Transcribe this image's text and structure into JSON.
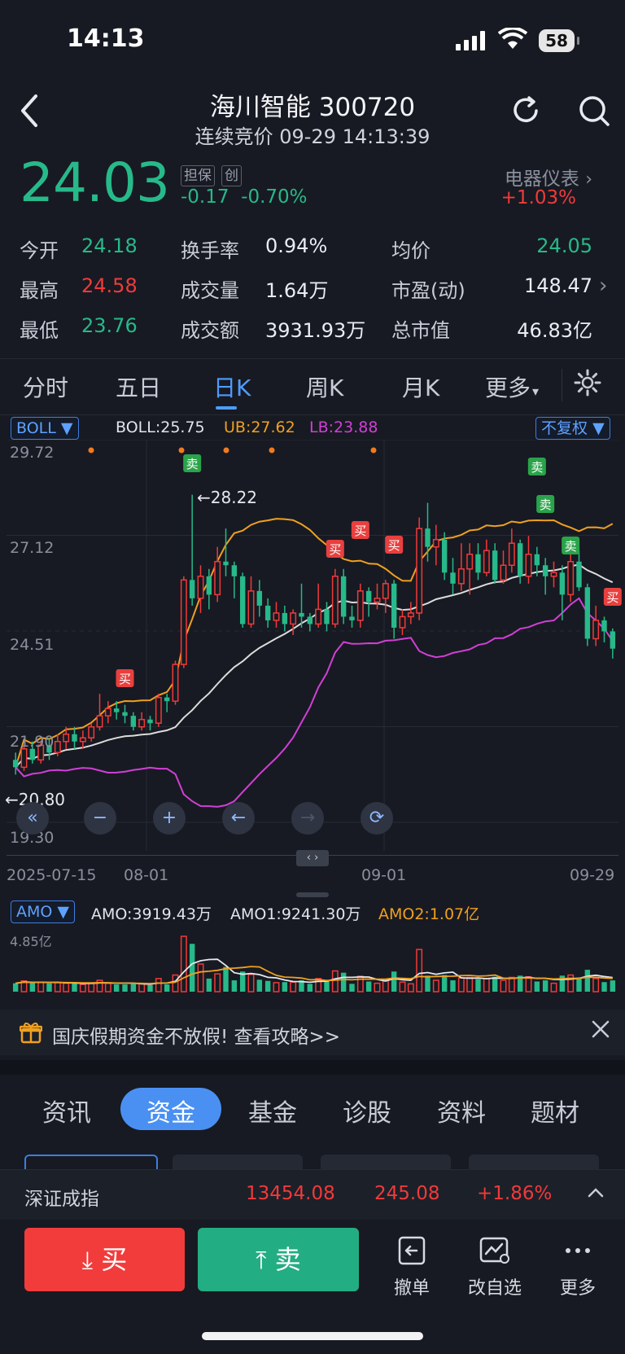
{
  "status_bar": {
    "time": "14:13",
    "battery": "58"
  },
  "header": {
    "title": "海川智能 300720",
    "subtitle": "连续竞价 09-29 14:13:39"
  },
  "quote": {
    "price": "24.03",
    "tag_1": "担保",
    "tag_2": "创",
    "change": "-0.17",
    "change_pct": "-0.70%",
    "sector_name": "电器仪表",
    "sector_pct": "+1.03%"
  },
  "stats": {
    "open_label": "今开",
    "open": "24.18",
    "high_label": "最高",
    "high": "24.58",
    "low_label": "最低",
    "low": "23.76",
    "turnover_label": "换手率",
    "turnover": "0.94%",
    "volume_label": "成交量",
    "volume": "1.64万",
    "amount_label": "成交额",
    "amount": "3931.93万",
    "avg_label": "均价",
    "avg": "24.05",
    "pe_label": "市盈(动)",
    "pe": "148.47",
    "mktcap_label": "总市值",
    "mktcap": "46.83亿"
  },
  "period_tabs": [
    "分时",
    "五日",
    "日K",
    "周K",
    "月K",
    "更多"
  ],
  "indicator": {
    "selector": "BOLL",
    "boll": "BOLL:25.75",
    "ub": "UB:27.62",
    "lb": "LB:23.88",
    "adjust": "不复权"
  },
  "chart_axis": {
    "y_ticks": [
      "29.72",
      "27.12",
      "24.51",
      "21.90",
      "19.30"
    ],
    "x_ticks": [
      "2025-07-15",
      "08-01",
      "09-01",
      "09-29"
    ],
    "max_label": "28.22",
    "min_label": "20.80"
  },
  "signals": {
    "buy": "买",
    "sell": "卖"
  },
  "amo": {
    "selector": "AMO",
    "amo": "AMO:3919.43万",
    "amo1": "AMO1:9241.30万",
    "amo2": "AMO2:1.07亿",
    "max": "4.85亿"
  },
  "banner": {
    "text": "国庆假期资金不放假! 查看攻略>>"
  },
  "news_tabs": [
    "资讯",
    "资金",
    "基金",
    "诊股",
    "资料",
    "题材"
  ],
  "index_bar": {
    "name": "深证成指",
    "value": "13454.08",
    "change": "245.08",
    "pct": "+1.86%"
  },
  "bottom": {
    "buy": "买",
    "sell": "卖",
    "cancel": "撤单",
    "edit_watch": "改自选",
    "more": "更多"
  },
  "colors": {
    "up": "#f03a3a",
    "down": "#27b98a",
    "accent": "#4f9bff",
    "ub_line": "#f0a020",
    "lb_line": "#d23fd6",
    "mid_line": "#dcdcdc"
  },
  "chart_data": {
    "type": "candlestick",
    "x_range": [
      "2025-07-15",
      "09-29"
    ],
    "ylim": [
      19.3,
      29.72
    ],
    "candles": [
      [
        21.0,
        20.8,
        21.2,
        20.6
      ],
      [
        20.8,
        21.3,
        21.4,
        20.7
      ],
      [
        21.3,
        21.0,
        21.5,
        20.9
      ],
      [
        21.0,
        21.4,
        21.5,
        20.9
      ],
      [
        21.4,
        21.2,
        21.6,
        21.0
      ],
      [
        21.2,
        21.5,
        21.7,
        21.1
      ],
      [
        21.5,
        21.7,
        21.9,
        21.3
      ],
      [
        21.7,
        21.5,
        21.9,
        21.3
      ],
      [
        21.5,
        21.6,
        21.8,
        21.3
      ],
      [
        21.6,
        21.9,
        22.0,
        21.5
      ],
      [
        21.9,
        22.2,
        22.8,
        21.8
      ],
      [
        22.2,
        22.4,
        22.6,
        22.0
      ],
      [
        22.4,
        22.3,
        22.6,
        22.1
      ],
      [
        22.3,
        22.2,
        22.5,
        22.0
      ],
      [
        22.2,
        21.9,
        22.3,
        21.8
      ],
      [
        21.9,
        22.1,
        22.3,
        21.8
      ],
      [
        22.1,
        22.0,
        22.2,
        21.8
      ],
      [
        22.0,
        22.7,
        22.8,
        21.9
      ],
      [
        22.7,
        22.6,
        22.8,
        22.3
      ],
      [
        22.6,
        23.6,
        23.7,
        22.5
      ],
      [
        23.6,
        25.9,
        26.0,
        23.5
      ],
      [
        25.9,
        25.4,
        28.22,
        25.2
      ],
      [
        25.4,
        26.0,
        26.3,
        25.0
      ],
      [
        26.0,
        25.5,
        26.2,
        25.1
      ],
      [
        25.5,
        26.4,
        26.8,
        25.3
      ],
      [
        26.4,
        26.3,
        27.3,
        26.0
      ],
      [
        26.3,
        26.0,
        26.4,
        25.4
      ],
      [
        26.0,
        24.7,
        26.1,
        24.6
      ],
      [
        24.7,
        25.6,
        26.0,
        24.6
      ],
      [
        25.6,
        25.2,
        25.9,
        24.9
      ],
      [
        25.2,
        24.8,
        25.4,
        24.6
      ],
      [
        24.8,
        25.0,
        25.3,
        24.6
      ],
      [
        25.0,
        24.7,
        25.2,
        24.5
      ],
      [
        24.7,
        25.0,
        25.1,
        24.4
      ],
      [
        25.0,
        24.9,
        25.8,
        24.6
      ],
      [
        24.9,
        24.7,
        25.0,
        24.5
      ],
      [
        24.7,
        25.1,
        25.8,
        24.6
      ],
      [
        25.1,
        24.7,
        25.3,
        24.5
      ],
      [
        24.7,
        26.0,
        26.2,
        24.6
      ],
      [
        26.0,
        24.9,
        26.2,
        24.7
      ],
      [
        24.9,
        24.8,
        25.2,
        24.6
      ],
      [
        24.8,
        25.6,
        25.8,
        24.6
      ],
      [
        25.6,
        25.3,
        25.7,
        24.9
      ],
      [
        25.3,
        25.4,
        25.8,
        25.1
      ],
      [
        25.4,
        25.8,
        25.9,
        25.0
      ],
      [
        25.8,
        24.6,
        25.9,
        24.3
      ],
      [
        24.6,
        24.9,
        25.1,
        24.4
      ],
      [
        24.9,
        25.0,
        25.3,
        24.7
      ],
      [
        25.0,
        27.3,
        27.6,
        24.8
      ],
      [
        27.3,
        26.8,
        28.0,
        26.4
      ],
      [
        26.8,
        27.0,
        27.4,
        26.3
      ],
      [
        27.0,
        26.1,
        27.2,
        25.9
      ],
      [
        26.1,
        25.8,
        26.5,
        25.5
      ],
      [
        25.8,
        26.2,
        26.9,
        25.6
      ],
      [
        26.2,
        26.6,
        26.9,
        25.5
      ],
      [
        26.6,
        26.1,
        26.9,
        25.9
      ],
      [
        26.1,
        26.7,
        27.0,
        26.0
      ],
      [
        26.7,
        25.9,
        26.9,
        25.8
      ],
      [
        25.9,
        26.3,
        26.7,
        25.8
      ],
      [
        26.3,
        26.9,
        27.3,
        26.1
      ],
      [
        26.9,
        26.0,
        27.0,
        25.8
      ],
      [
        26.0,
        26.6,
        27.1,
        25.8
      ],
      [
        26.6,
        26.3,
        26.8,
        26.0
      ],
      [
        26.3,
        26.0,
        26.5,
        25.5
      ],
      [
        26.0,
        26.1,
        26.4,
        25.7
      ],
      [
        26.1,
        25.5,
        26.3,
        24.8
      ],
      [
        25.5,
        26.4,
        26.6,
        25.3
      ],
      [
        26.4,
        25.7,
        26.7,
        25.6
      ],
      [
        25.7,
        24.3,
        25.8,
        24.1
      ],
      [
        24.3,
        24.8,
        25.2,
        24.1
      ],
      [
        24.8,
        24.5,
        24.9,
        24.2
      ],
      [
        24.5,
        24.03,
        24.58,
        23.76
      ]
    ]
  }
}
